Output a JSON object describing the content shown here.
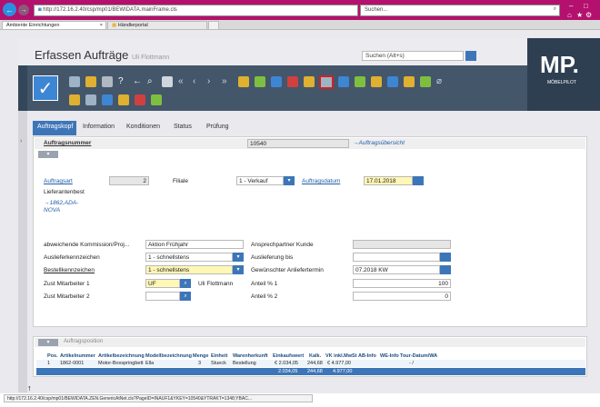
{
  "browser": {
    "url": "http://172.16.2.40/csp/mp01/BEWIDATA.mainFrame.cls",
    "search_placeholder": "Suchen...",
    "tabs": [
      {
        "label": "Ambiente Einrichtungen"
      },
      {
        "label": "Händlerportal"
      }
    ],
    "status_url": "http://172.16.2.40/csp/mp01/BEWIDATA.ZEN.GenericAtNet.cls?PageID=INAUF1&YKEY=10540&YTRAKT=1348;YBAC..."
  },
  "app": {
    "title": "Erfassen Aufträge",
    "user": "Uli Flottmann",
    "search_placeholder": "Suchen (Alt+s)",
    "logo_main": "MP.",
    "logo_sub": "MÖBELPILOT"
  },
  "form_tabs": [
    {
      "label": "Auftragskopf"
    },
    {
      "label": "Information"
    },
    {
      "label": "Konditionen"
    },
    {
      "label": "Status"
    },
    {
      "label": "Prüfung"
    }
  ],
  "form": {
    "auftragsnummer_label": "Auftragsnummer",
    "auftragsnummer_value": "10540",
    "uebersicht_link": "→Auftragsübersicht",
    "auftragsart_label": "Auftragsart",
    "auftragsart_value": "2",
    "lieferantenbest": "Lieferantenbest",
    "lieferant_link": "→1862,ADA-NOVA",
    "filiale_label": "Filiale",
    "filiale_value": "1 - Verkauf",
    "auftragsdatum_label": "Auftragsdatum",
    "auftragsdatum_value": "17.01.2018",
    "kommission_label": "abweichende Kommission/Proj...",
    "kommission_value": "Aktion Frühjahr",
    "ansprechpartner_label": "Ansprechpartner Kunde",
    "auslieferkennzeichen_label": "Auslieferkennzeichen",
    "auslieferkennzeichen_value": "1 - schnellstens",
    "auslieferung_bis_label": "Auslieferung bis",
    "bestellkennzeichen_label": "Bestellkennzeichen",
    "bestellkennzeichen_value": "1 - schnellstens",
    "anliefertermin_label": "Gewünschter Anliefertermin",
    "anliefertermin_value": "07.2018 KW",
    "mitarbeiter1_label": "Zust Mitarbeiter 1",
    "mitarbeiter1_value": "UF",
    "mitarbeiter1_name": "Uli Flottmann",
    "anteil1_label": "Anteil % 1",
    "anteil1_value": "100",
    "mitarbeiter2_label": "Zust Mitarbeiter 2",
    "anteil2_label": "Anteil % 2",
    "anteil2_value": "0"
  },
  "positions": {
    "section_label": "Auftragsposition",
    "headers": [
      "Pos.",
      "Artikelnummer",
      "Artikelbezeichnung",
      "Modellbezeichnung",
      "Menge",
      "Einheit",
      "Warenherkunft",
      "Einkaufswert",
      "Kalk.",
      "VK inkl.MwSt",
      "AB-Info",
      "WE-Info",
      "Tour-Datum/WA"
    ],
    "row": [
      "1",
      "1862-0001",
      "Motor-Boxspringbett",
      "Ella",
      "3",
      "Stueck",
      "Bestellung",
      "€ 2.034,05",
      "244,68",
      "€ 4.977,00",
      "",
      "",
      "- /"
    ],
    "sum_einkauf": "2.034,05",
    "sum_kalk": "244,68",
    "sum_vk": "4.977,00"
  },
  "colors": {
    "browser_accent": "#b4106e",
    "tab_active": "#3d76b8",
    "required_field": "#fff7b6",
    "toolbar_dark": "#44566a"
  }
}
